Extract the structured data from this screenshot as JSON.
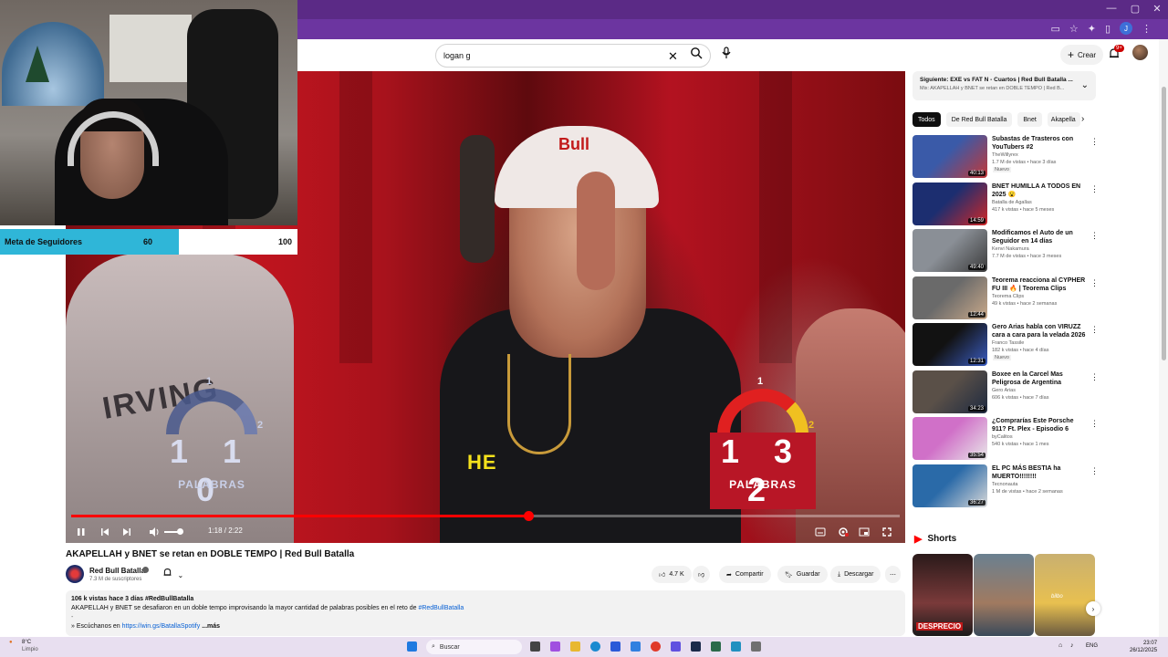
{
  "browser": {
    "window_controls": [
      "—",
      "▢",
      "✕"
    ],
    "profile_initial": "J"
  },
  "youtube": {
    "search_value": "logan g",
    "create_label": "Crear",
    "notifications_badge": "9+"
  },
  "player": {
    "overlay": {
      "left_score": "1 1 0",
      "left_label": "PALABRAS",
      "right_score": "1 3 2",
      "right_label": "PALABRAS",
      "gauge_mark_1": "1",
      "gauge_mark_2": "2",
      "subtitle": "HE"
    },
    "progress_fraction": 0.552,
    "time": "1:18 / 2:22"
  },
  "stream_overlay": {
    "goal_label": "Meta de Seguidores",
    "goal_current": "60",
    "goal_max": "100",
    "goal_fraction": 0.6
  },
  "video": {
    "title": "AKAPELLAH y BNET se retan en DOBLE TEMPO | Red Bull Batalla",
    "channel": "Red Bull Batalla",
    "subscribers": "7.3 M de suscriptores",
    "likes": "4.7 K",
    "share": "Compartir",
    "save": "Guardar",
    "download": "Descargar",
    "more": "⋯",
    "desc_meta": "106 k vistas  hace 3 días  #RedBullBatalla",
    "desc_line": "AKAPELLAH y BNET se desafiaron en un doble tempo improvisando la mayor cantidad de palabras posibles en el reto de",
    "desc_hashtag": "#RedBullBatalla",
    "desc_dots": "-",
    "desc_listen": "» Escúchanos en",
    "desc_link": "https://win.gs/BatallaSpotify",
    "desc_more": "...más"
  },
  "sidebar": {
    "next_title": "Siguiente: EXE vs FAT N - Cuartos | Red Bull Batalla ...",
    "next_sub": "Mix: AKAPELLAH y BNET se retan en DOBLE TEMPO | Red B...",
    "chips": [
      "Todos",
      "De Red Bull Batalla",
      "Bnet",
      "Akapella"
    ],
    "items": [
      {
        "title": "Subastas de Trasteros con YouTubers #2",
        "channel": "TheWillyrex",
        "meta": "1.7 M de vistas • hace 3 días",
        "badge": "Nuevo",
        "duration": "40:13",
        "c1": "#3a5aa8",
        "c2": "#c23838"
      },
      {
        "title": "BNET HUMILLA A TODOS EN 2025 😮",
        "channel": "Batalla de Agallas",
        "meta": "417 k vistas • hace 5 meses",
        "badge": "",
        "duration": "14:59",
        "c1": "#1c2e70",
        "c2": "#d02828"
      },
      {
        "title": "Modificamos el Auto de un Seguidor en 14 días",
        "channel": "Kenvi Nakamura",
        "meta": "7.7 M de vistas • hace 3 meses",
        "badge": "",
        "duration": "49:40",
        "c1": "#8a8f96",
        "c2": "#3b3b3b"
      },
      {
        "title": "Teorema reacciona al CYPHER FU III 🔥 | Teorema Clips",
        "channel": "Teorema Clips",
        "meta": "49 k vistas • hace 2 semanas",
        "badge": "",
        "duration": "12:44",
        "c1": "#6a6a6a",
        "c2": "#c9a98a"
      },
      {
        "title": "Gero Arias habla con VIRUZZ cara a cara para la velada 2026",
        "channel": "Franco Tassile",
        "meta": "182 k vistas • hace 4 días",
        "badge": "Nuevo",
        "duration": "12:31",
        "c1": "#121212",
        "c2": "#3a5cc0"
      },
      {
        "title": "Boxee en la Carcel Mas Peligrosa de Argentina",
        "channel": "Gero Arias",
        "meta": "606 k vistas • hace 7 días",
        "badge": "",
        "duration": "34:23",
        "c1": "#5a5048",
        "c2": "#1e2a40"
      },
      {
        "title": "¿Comprarías Este Porsche 911? Ft. Plex - Episodio 6",
        "channel": "byCalitos",
        "meta": "540 k vistas • hace 1 mes",
        "badge": "",
        "duration": "35:54",
        "c1": "#d070c8",
        "c2": "#e8e8e8"
      },
      {
        "title": "EL PC MÁS BESTIA ha MUERTO!!!!!!!!",
        "channel": "Tecnonauta",
        "meta": "1 M de vistas • hace 2 semanas",
        "badge": "",
        "duration": "36:27",
        "c1": "#2a6aa8",
        "c2": "#d8d8d8"
      }
    ],
    "shorts_label": "Shorts",
    "short_caption": "DESPRECIO",
    "short_label_3": "bilbo"
  },
  "taskbar": {
    "weather_temp": "8°C",
    "weather_desc": "Limpio",
    "search_placeholder": "Buscar",
    "lang": "ENG",
    "time": "23:07",
    "date": "26/12/2025"
  }
}
